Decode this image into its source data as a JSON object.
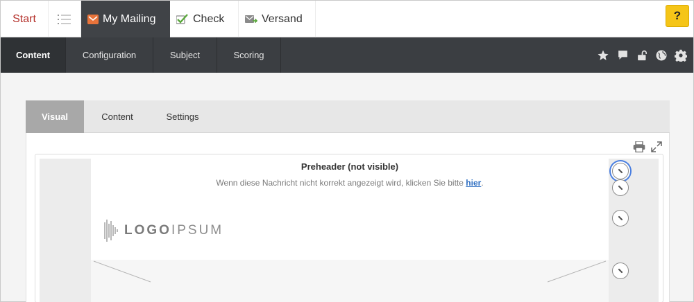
{
  "top_tabs": {
    "start": "Start",
    "mailing": "My Mailing",
    "check": "Check",
    "versand": "Versand",
    "help": "?"
  },
  "nav_tabs": [
    "Content",
    "Configuration",
    "Subject",
    "Scoring"
  ],
  "panel_tabs": [
    "Visual",
    "Content",
    "Settings"
  ],
  "preview": {
    "preheader_title": "Preheader (not visible)",
    "preheader_text": "Wenn diese Nachricht nicht korrekt angezeigt wird, klicken Sie bitte",
    "preheader_link": "hier",
    "preheader_period": ".",
    "logo_bold": "LOGO",
    "logo_light": "IPSUM"
  },
  "colors": {
    "accent_red": "#b4312b",
    "active_tab": "#404347",
    "help_yellow": "#f5c518",
    "link_blue": "#2f6fc2",
    "focus_ring": "#4a7fe0"
  },
  "icons": [
    "list-icon",
    "envelope-icon",
    "check-icon",
    "send-icon",
    "help-icon",
    "star-icon",
    "comment-icon",
    "unlock-icon",
    "globe-icon",
    "gear-icon",
    "print-icon",
    "expand-icon",
    "edit-icon"
  ]
}
